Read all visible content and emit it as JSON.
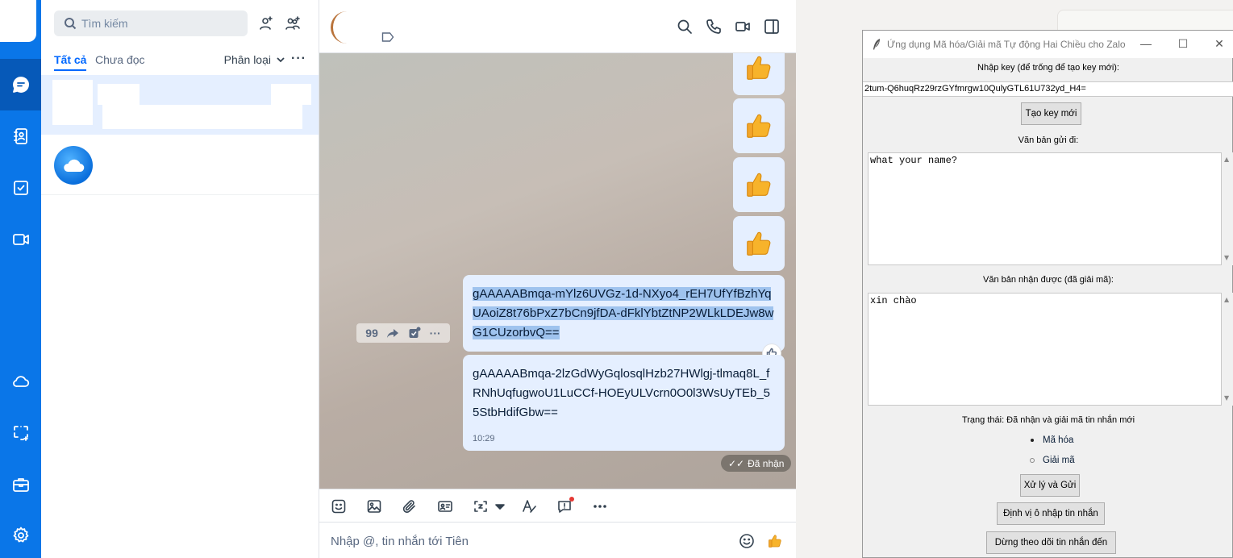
{
  "nav": {
    "items": [
      "messages",
      "contacts",
      "todo",
      "video-call"
    ],
    "bottom": [
      "cloud",
      "screenshot",
      "toolbox",
      "settings"
    ]
  },
  "conversations": {
    "search_placeholder": "Tìm kiếm",
    "filters": {
      "all": "Tất cả",
      "unread": "Chưa đọc",
      "classify": "Phân loại"
    }
  },
  "chat": {
    "messages": [
      {
        "text": "gAAAAABmqa-mYlz6UVGz-1d-NXyo4_rEH7UfYfBzhYqUAoiZ8t76bPxZ7bCn9jfDA-dFklYbtZtNP2WLkLDEJw8wG1CUzorbvQ==",
        "selected": true
      },
      {
        "text": "gAAAAABmqa-2lzGdWyGqlosqlHzb27HWlgj-tlmaq8L_fRNhUqfugwoU1LuCCf-HOEyULVcrn0O0l3WsUyTEb_55StbHdifGbw==",
        "time": "10:29"
      }
    ],
    "status": "Đã nhận",
    "composer_placeholder": "Nhập @, tin nhắn tới Tiên",
    "action_quote": "99"
  },
  "tkapp": {
    "title": "Ứng dụng Mã hóa/Giải mã Tự động Hai Chiều cho Zalo",
    "key_label": "Nhập key (để trống để tạo key mới):",
    "key_value": "2tum-Q6huqRz29rzGYfmrgw10QulyGTL61U732yd_H4=",
    "new_key_button": "Tạo key mới",
    "send_label": "Văn bản gửi đi:",
    "send_text": "what your name?",
    "recv_label": "Văn bản nhận được (đã giải mã):",
    "recv_text": "xin chào",
    "status": "Trạng thái: Đã nhận và giải mã tin nhắn mới",
    "mode_encrypt": "Mã hóa",
    "mode_decrypt": "Giải mã",
    "mode_selected": "encrypt",
    "process_button": "Xử lý và Gửi",
    "locate_button": "Định vị ô nhập tin nhắn",
    "stop_button": "Dừng theo dõi tin nhắn đến"
  },
  "colors": {
    "accent": "#0068ff",
    "rail": "#0a76e8",
    "bubble": "#e5efff",
    "selection": "#9fc3ee"
  }
}
